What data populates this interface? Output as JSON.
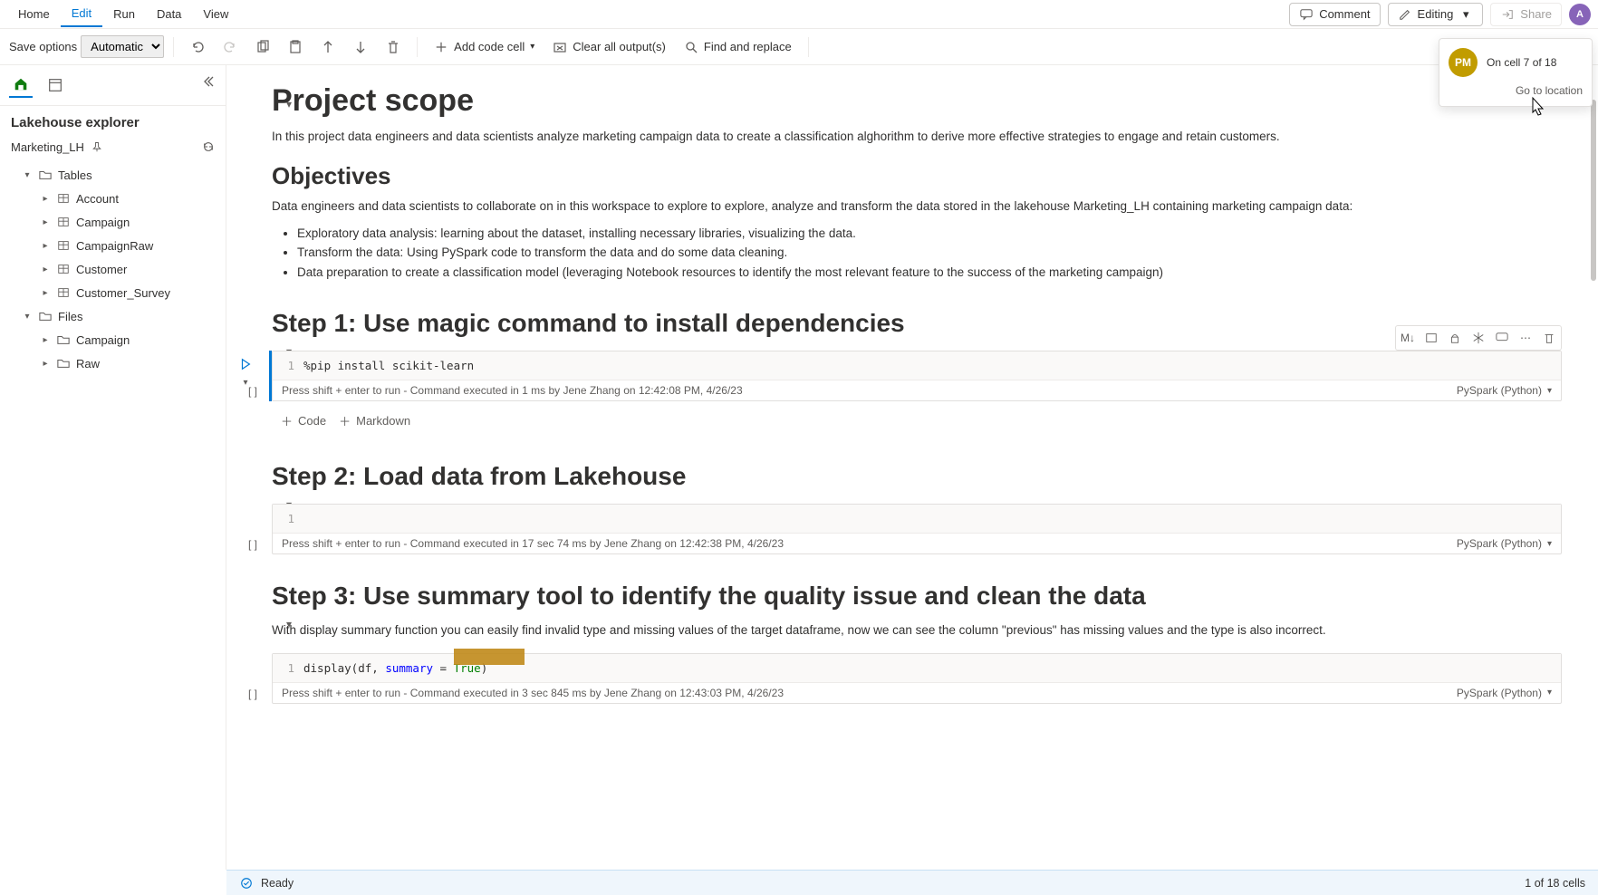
{
  "menubar": {
    "items": [
      "Home",
      "Edit",
      "Run",
      "Data",
      "View"
    ],
    "active_index": 1,
    "comment": "Comment",
    "editing": "Editing",
    "share": "Share"
  },
  "toolbar": {
    "save_label": "Save options",
    "save_mode": "Automatic",
    "add_code": "Add code cell",
    "clear_output": "Clear all output(s)",
    "find_replace": "Find and replace"
  },
  "sidebar": {
    "title": "Lakehouse explorer",
    "lakehouse_name": "Marketing_LH",
    "tables_label": "Tables",
    "files_label": "Files",
    "tables": [
      "Account",
      "Campaign",
      "CampaignRaw",
      "Customer",
      "Customer_Survey"
    ],
    "files": [
      "Campaign",
      "Raw"
    ]
  },
  "presence": {
    "initials": "PM",
    "status": "On cell 7 of 18",
    "link": "Go to location"
  },
  "notebook": {
    "scope_title": "Project scope",
    "scope_desc": "In this project data engineers and data scientists analyze marketing campaign data to create a classification alghorithm to derive more effective strategies to engage and retain customers.",
    "objectives_title": "Objectives",
    "objectives_desc": "Data engineers and data scientists to collaborate on in this workspace to explore to explore, analyze and transform the data stored in the lakehouse Marketing_LH containing marketing campaign data:",
    "objectives_list": [
      "Exploratory data analysis: learning about the dataset, installing necessary libraries, visualizing the data.",
      "Transform the data: Using PySpark code to transform the data and do some data cleaning.",
      "Data preparation to create a classification model (leveraging Notebook resources to identify the most relevant feature to the success of the marketing campaign)"
    ],
    "step1_title": "Step 1: Use magic command to install dependencies",
    "step2_title": "Step 2: Load data from Lakehouse",
    "step3_title": "Step 3: Use summary tool to identify the quality issue and clean the data",
    "step3_desc": "With display summary function you can easily find invalid type and missing values of the target dataframe, now we can see the column \"previous\" has missing values and the type is also incorrect.",
    "cell1_code": "%pip install scikit-learn",
    "cell1_status_hint": "Press shift + enter to run",
    "cell1_status_exec": "Command executed in 1 ms by Jene Zhang on 12:42:08 PM, 4/26/23",
    "cell2_status_exec": "Command executed in 17 sec 74 ms by Jene Zhang on 12:42:38 PM, 4/26/23",
    "cell3_code_pre": "display(df, ",
    "cell3_code_kw": "summary",
    "cell3_code_mid": " = ",
    "cell3_code_val": "True",
    "cell3_code_post": ")",
    "cell3_status_exec": "Command executed in 3 sec 845 ms by Jene Zhang on 12:43:03 PM, 4/26/23",
    "lang": "PySpark (Python)",
    "add_code": "Code",
    "add_markdown": "Markdown",
    "cell_toolbar_md": "M↓"
  },
  "statusbar": {
    "ready": "Ready",
    "cells": "1 of 18 cells"
  }
}
